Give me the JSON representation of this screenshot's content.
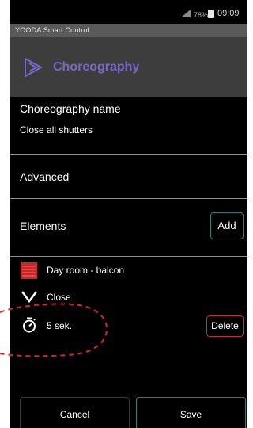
{
  "status_bar": {
    "battery_percent": "78%",
    "time": "09:09"
  },
  "app": {
    "title": "YOODA Smart Control"
  },
  "header": {
    "title": "Choreography",
    "icon": "play-outline-icon"
  },
  "choreography": {
    "name_label": "Choreography name",
    "name_value": "Close all shutters"
  },
  "advanced": {
    "label": "Advanced"
  },
  "elements": {
    "label": "Elements",
    "add_label": "Add",
    "items": {
      "room": "Day room - balcon",
      "action": "Close",
      "delay": "5  sek.",
      "delete_label": "Delete"
    }
  },
  "footer": {
    "cancel_label": "Cancel",
    "save_label": "Save"
  },
  "colors": {
    "accent_purple": "#7b67c9",
    "teal_border": "#2b7f79",
    "red_border": "#c43131",
    "annotation_red": "#d62828"
  }
}
